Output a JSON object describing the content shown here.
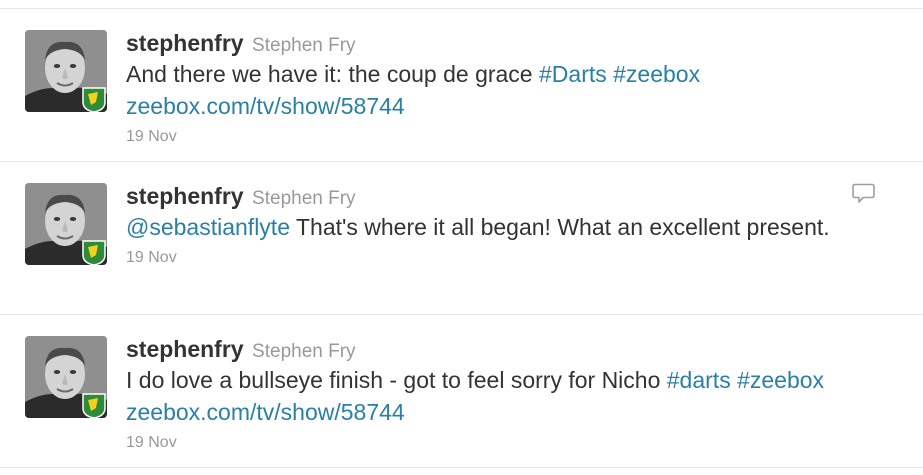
{
  "tweets": [
    {
      "screen_name": "stephenfry",
      "full_name": "Stephen Fry",
      "text_parts": [
        {
          "text": "And there we have it: the coup de grace ",
          "link": false
        },
        {
          "text": "#Darts",
          "link": true
        },
        {
          "text": " ",
          "link": false
        },
        {
          "text": "#zeebox",
          "link": true
        },
        {
          "text": " ",
          "link": false
        },
        {
          "text": "zeebox.com/tv/show/58744",
          "link": true
        }
      ],
      "timestamp": "19 Nov"
    },
    {
      "screen_name": "stephenfry",
      "full_name": "Stephen Fry",
      "text_parts": [
        {
          "text": "@sebastianflyte",
          "link": true
        },
        {
          "text": " That's where it all began! What an excellent present.",
          "link": false
        }
      ],
      "timestamp": "19 Nov",
      "show_reply_icon": true
    },
    {
      "screen_name": "stephenfry",
      "full_name": "Stephen Fry",
      "text_parts": [
        {
          "text": "I do love a bullseye finish - got to feel sorry for Nicho ",
          "link": false
        },
        {
          "text": "#darts",
          "link": true
        },
        {
          "text": " ",
          "link": false
        },
        {
          "text": "#zeebox",
          "link": true
        },
        {
          "text": " ",
          "link": false
        },
        {
          "text": "zeebox.com/tv/show/58744",
          "link": true
        }
      ],
      "timestamp": "19 Nov"
    }
  ],
  "icons": {
    "avatar_badge": "norwich-city-badge-icon",
    "reply": "speech-bubble-reply-icon"
  },
  "colors": {
    "link": "#2a7fa8",
    "text": "#333333",
    "muted": "#999999",
    "badge_green": "#2e8b3a",
    "badge_yellow": "#f2d21b"
  }
}
